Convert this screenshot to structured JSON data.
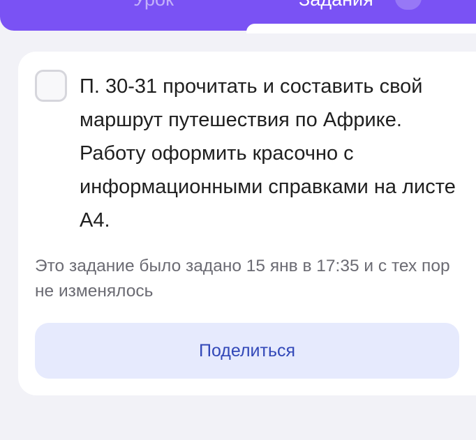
{
  "tabs": [
    {
      "label": "Урок",
      "active": false
    },
    {
      "label": "Задания",
      "active": true
    }
  ],
  "colors": {
    "header_purple": "#7a52f4",
    "page_bg": "#f2f2f7",
    "card_bg": "#ffffff",
    "share_button_bg": "#e6eafd",
    "share_button_text": "#3248b8"
  },
  "task": {
    "checked": false,
    "text": "П. 30-31 прочитать и составить свой маршрут путешествия по Африке. Работу оформить красочно с информационными справками на листе А4.",
    "meta": "Это задание было задано 15 янв в 17:35 и с тех пор не изменялось",
    "share_label": "Поделиться"
  }
}
